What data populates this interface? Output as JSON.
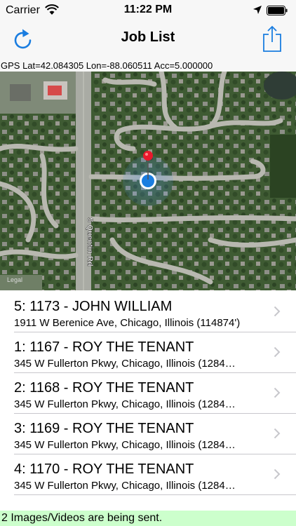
{
  "status_bar": {
    "carrier": "Carrier",
    "time": "11:22 PM",
    "icons": [
      "wifi-icon",
      "location-arrow-icon",
      "battery-icon"
    ]
  },
  "nav": {
    "title": "Job List",
    "left_icon": "refresh-icon",
    "right_icon": "share-icon",
    "tint": "#1a7de0"
  },
  "gps": {
    "text": "GPS Lat=42.084305 Lon=-88.060511  Acc=5.000000"
  },
  "map": {
    "street_label": "S Quentin Rd",
    "legal_label": "Legal",
    "pin_color": "#e8192c",
    "user_location_color": "#1a7de0"
  },
  "jobs": [
    {
      "title": "5: 1173 - JOHN WILLIAM",
      "address": "1911 W Berenice Ave, Chicago, Illinois (114874')"
    },
    {
      "title": "1: 1167 - ROY THE TENANT",
      "address": "345 W Fullerton Pkwy, Chicago, Illinois (1284…"
    },
    {
      "title": "2: 1168 - ROY THE TENANT",
      "address": "345 W Fullerton Pkwy, Chicago, Illinois (1284…"
    },
    {
      "title": "3: 1169 - ROY THE TENANT",
      "address": "345 W Fullerton Pkwy, Chicago, Illinois (1284…"
    },
    {
      "title": "4: 1170 - ROY THE TENANT",
      "address": "345 W Fullerton Pkwy, Chicago, Illinois (1284…"
    }
  ],
  "footer": {
    "message": "2 Images/Videos are being sent.",
    "background": "#ccffcc"
  }
}
